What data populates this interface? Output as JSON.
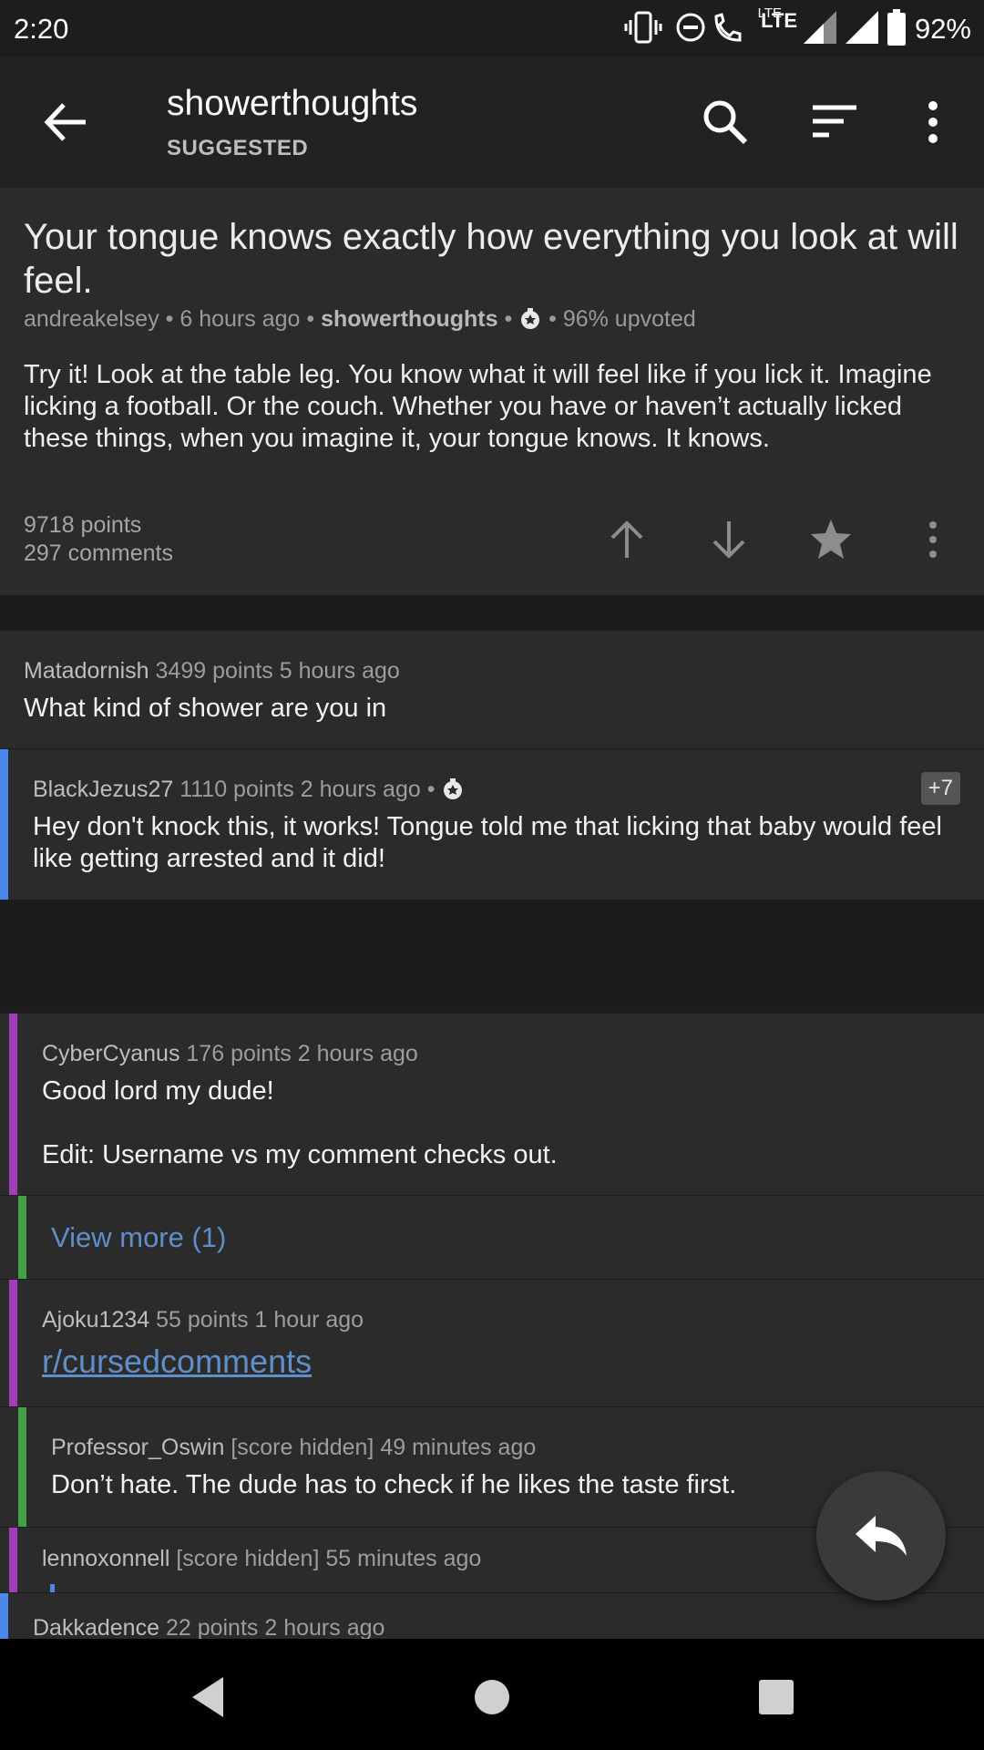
{
  "status_bar": {
    "time": "2:20",
    "network_label": "LTE",
    "battery": "92%",
    "icons": [
      "vibrate-icon",
      "dnd-icon",
      "wifi-calling-icon",
      "signal-icon",
      "signal-icon",
      "battery-icon"
    ]
  },
  "app_bar": {
    "title": "showerthoughts",
    "subtitle": "SUGGESTED",
    "icons": [
      "back-arrow-icon",
      "search-icon",
      "sort-icon",
      "more-vert-icon"
    ]
  },
  "post": {
    "title": "Your tongue knows exactly how everything you look at will feel.",
    "author": "andreakelsey",
    "age": "6 hours ago",
    "subreddit": "showerthoughts",
    "upvote_ratio": "96% upvoted",
    "body": "Try it! Look at the table leg. You know what it will feel like if you lick it. Imagine licking a football. Or the couch. Whether you have or haven’t actually licked these things, when you imagine it, your tongue knows. It knows.",
    "points": "9718 points",
    "comments": "297 comments"
  },
  "comments": [
    {
      "author": "Matadornish",
      "score": "3499 points",
      "age": "5 hours ago",
      "body": "What kind of shower are you in"
    },
    {
      "author": "BlackJezus27",
      "score": "1110 points",
      "age": "2 hours ago",
      "badge": "+7",
      "body": "Hey don't knock this, it works! Tongue told me that licking that baby would feel like getting arrested and it did!"
    },
    {
      "author": "CyberCyanus",
      "score": "176 points",
      "age": "2 hours ago",
      "body_line1": "Good lord my dude!",
      "body_line2": "Edit: Username vs my comment checks out."
    },
    {
      "view_more": "View more (1)"
    },
    {
      "author": "Ajoku1234",
      "score": "55 points",
      "age": "1 hour ago",
      "link": "r/cursedcomments"
    },
    {
      "author": "Professor_Oswin",
      "score": "[score hidden]",
      "age": "49 minutes ago",
      "body": "Don’t hate. The dude has to check if he likes the taste first."
    },
    {
      "author": "lennoxonnell",
      "score": "[score hidden]",
      "age": "55 minutes ago"
    },
    {
      "author": "Dakkadence",
      "score": "22 points",
      "age": "2 hours ago"
    }
  ],
  "colors": {
    "depth_blue": "#4a88ec",
    "depth_purple": "#a23cb8",
    "depth_green": "#43a047",
    "link": "#5f8fc9"
  }
}
